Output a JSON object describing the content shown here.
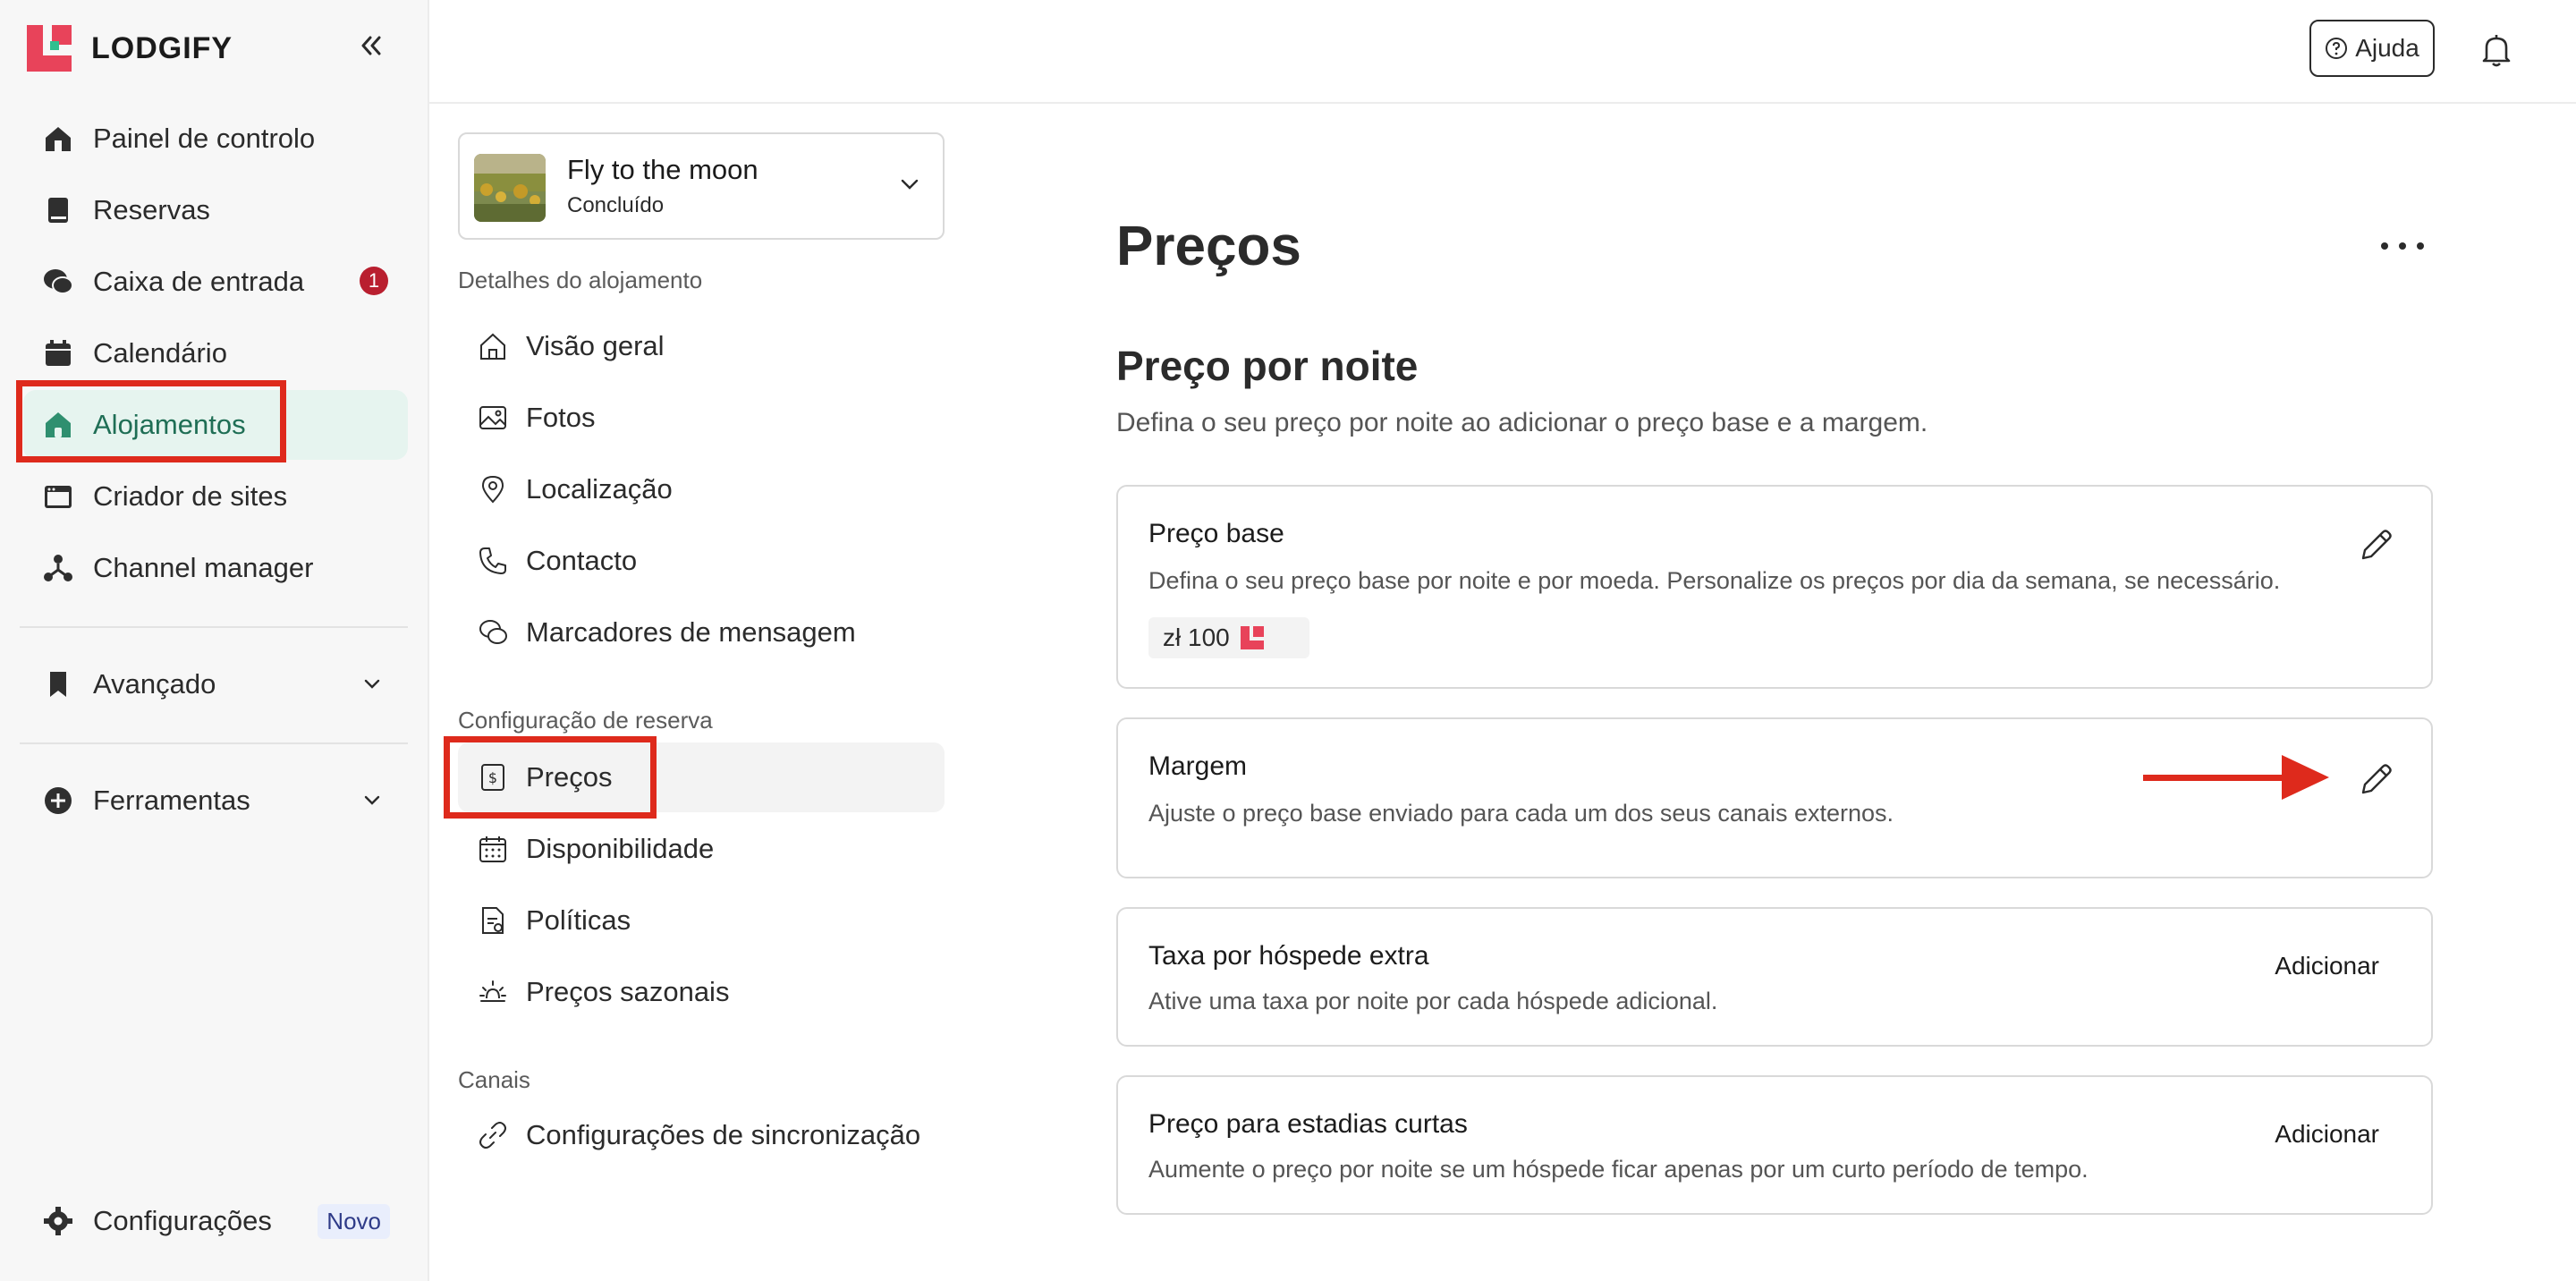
{
  "brand": {
    "name": "LODGIFY"
  },
  "sidebar": {
    "items": [
      {
        "label": "Painel de controlo",
        "icon": "home-icon"
      },
      {
        "label": "Reservas",
        "icon": "book-icon"
      },
      {
        "label": "Caixa de entrada",
        "icon": "chat-icon",
        "badge": "1"
      },
      {
        "label": "Calendário",
        "icon": "calendar-icon"
      },
      {
        "label": "Alojamentos",
        "icon": "house-icon",
        "active": true
      },
      {
        "label": "Criador de sites",
        "icon": "browser-icon"
      },
      {
        "label": "Channel manager",
        "icon": "network-icon"
      },
      {
        "label": "Avançado",
        "icon": "bookmark-icon"
      },
      {
        "label": "Ferramentas",
        "icon": "plus-circle-icon"
      }
    ],
    "settings": {
      "label": "Configurações",
      "badge": "Novo"
    }
  },
  "topbar": {
    "help_label": "Ajuda"
  },
  "listing": {
    "name": "Fly to the moon",
    "status": "Concluído"
  },
  "subnav": {
    "sections": [
      {
        "title": "Detalhes do alojamento",
        "items": [
          "Visão geral",
          "Fotos",
          "Localização",
          "Contacto",
          "Marcadores de mensagem"
        ]
      },
      {
        "title": "Configuração de reserva",
        "items": [
          "Preços",
          "Disponibilidade",
          "Políticas",
          "Preços sazonais"
        ]
      },
      {
        "title": "Canais",
        "items": [
          "Configurações de sincronização"
        ]
      }
    ]
  },
  "main": {
    "title": "Preços",
    "section_title": "Preço por noite",
    "section_desc": "Defina o seu preço por noite ao adicionar o preço base e a margem.",
    "cards": [
      {
        "title": "Preço base",
        "desc": "Defina o seu preço base por noite e por moeda. Personalize os preços por dia da semana, se necessário.",
        "value": "zł 100"
      },
      {
        "title": "Margem",
        "desc": "Ajuste o preço base enviado para cada um dos seus canais externos."
      },
      {
        "title": "Taxa por hóspede extra",
        "desc": "Ative uma taxa por noite por cada hóspede adicional.",
        "action": "Adicionar"
      },
      {
        "title": "Preço para estadias curtas",
        "desc": "Aumente o preço por noite se um hóspede ficar apenas por um curto período de tempo.",
        "action": "Adicionar"
      }
    ]
  },
  "colors": {
    "accent": "#1f6e55",
    "active_bg": "#e6f4ef",
    "brand": "#e8435a",
    "highlight": "#de2a1c",
    "badge": "#b91f2f"
  }
}
